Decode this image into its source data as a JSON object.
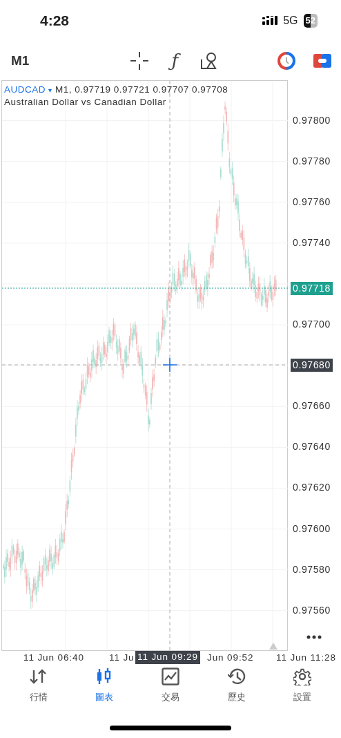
{
  "status_bar": {
    "time": "4:28",
    "network": "5G",
    "battery": "52"
  },
  "toolbar": {
    "timeframe": "M1",
    "function_symbol": "ƒ"
  },
  "chart": {
    "symbol": "AUDCAD",
    "symbol_caret": "▾",
    "ohlc": "M1, 0.97719 0.97721 0.97707 0.97708",
    "description": "Australian Dollar vs Canadian Dollar",
    "price_axis": [
      "0.97800",
      "0.97780",
      "0.97760",
      "0.97740",
      "0.97700",
      "0.97660",
      "0.97640",
      "0.97620",
      "0.97600",
      "0.97580",
      "0.97560"
    ],
    "current_price": "0.97718",
    "crosshair_price": "0.97680",
    "crosshair_time": "11 Jun 09:29",
    "time_axis": [
      "11 Jun 06:40",
      "11 Ju",
      "Jun 09:52",
      "11 Jun 11:28"
    ]
  },
  "tabs": [
    {
      "label": "行情",
      "selected": false
    },
    {
      "label": "圖表",
      "selected": true
    },
    {
      "label": "交易",
      "selected": false
    },
    {
      "label": "歷史",
      "selected": false
    },
    {
      "label": "設置",
      "selected": false
    }
  ]
}
